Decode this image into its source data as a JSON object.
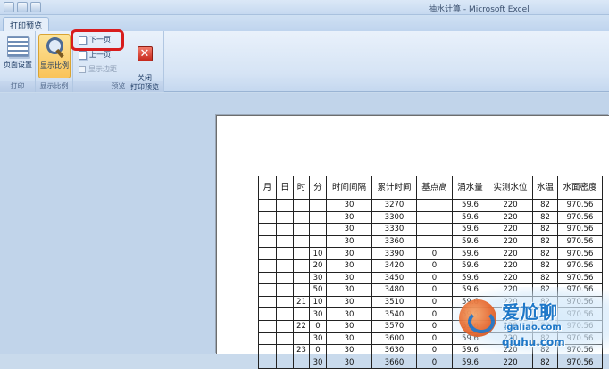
{
  "window": {
    "title": "抽水计算 - Microsoft Excel"
  },
  "ribbon": {
    "active_tab": "打印预览",
    "groups": [
      {
        "label": "打印",
        "buttons": [
          {
            "label": "页面设置",
            "icon": "page-setup-icon"
          }
        ]
      },
      {
        "label": "显示比例",
        "buttons": [
          {
            "label": "显示比例",
            "icon": "magnifier-icon"
          }
        ]
      },
      {
        "label": "预览",
        "buttons": [
          {
            "label": "下一页",
            "icon": "next-page-icon"
          },
          {
            "label": "上一页",
            "icon": "previous-page-icon"
          },
          {
            "label": "显示边距",
            "icon": "checkbox-icon",
            "disabled": true
          }
        ]
      },
      {
        "label": "",
        "buttons": [
          {
            "label": "关闭\n打印预览",
            "icon": "close-icon"
          }
        ]
      }
    ]
  },
  "sheet": {
    "headers": [
      "月",
      "日",
      "时",
      "分",
      "时间间隔",
      "累计时间",
      "基点高",
      "涌水量",
      "实测水位",
      "水温",
      "水面密度"
    ],
    "rows": [
      [
        "",
        "",
        "",
        "",
        "30",
        "3270",
        "",
        "59.6",
        "220",
        "82",
        "970.56"
      ],
      [
        "",
        "",
        "",
        "",
        "30",
        "3300",
        "",
        "59.6",
        "220",
        "82",
        "970.56"
      ],
      [
        "",
        "",
        "",
        "",
        "30",
        "3330",
        "",
        "59.6",
        "220",
        "82",
        "970.56"
      ],
      [
        "",
        "",
        "",
        "",
        "30",
        "3360",
        "",
        "59.6",
        "220",
        "82",
        "970.56"
      ],
      [
        "",
        "",
        "",
        "10",
        "30",
        "3390",
        "0",
        "59.6",
        "220",
        "82",
        "970.56"
      ],
      [
        "",
        "",
        "",
        "20",
        "30",
        "3420",
        "0",
        "59.6",
        "220",
        "82",
        "970.56"
      ],
      [
        "",
        "",
        "",
        "30",
        "30",
        "3450",
        "0",
        "59.6",
        "220",
        "82",
        "970.56"
      ],
      [
        "",
        "",
        "",
        "50",
        "30",
        "3480",
        "0",
        "59.6",
        "220",
        "82",
        "970.56"
      ],
      [
        "",
        "",
        "21",
        "10",
        "30",
        "3510",
        "0",
        "59.6",
        "220",
        "82",
        "970.56"
      ],
      [
        "",
        "",
        "",
        "30",
        "30",
        "3540",
        "0",
        "59.6",
        "220",
        "82",
        "970.56"
      ],
      [
        "",
        "",
        "22",
        "0",
        "30",
        "3570",
        "0",
        "59.6",
        "220",
        "82",
        "970.56"
      ],
      [
        "",
        "",
        "",
        "30",
        "30",
        "3600",
        "0",
        "59.6",
        "220",
        "82",
        "970.56"
      ],
      [
        "",
        "",
        "23",
        "0",
        "30",
        "3630",
        "0",
        "59.6",
        "220",
        "82",
        "970.56"
      ],
      [
        "",
        "",
        "",
        "30",
        "30",
        "3660",
        "0",
        "59.6",
        "220",
        "82",
        "970.56"
      ]
    ]
  },
  "watermark": {
    "line1": "爱尬聊",
    "line2": "igaliao.com",
    "line3": "qiuhu.com"
  },
  "colors": {
    "highlight": "#d81d1d",
    "ribbon": "#dde8f6",
    "workspace": "#c1d4ea"
  }
}
